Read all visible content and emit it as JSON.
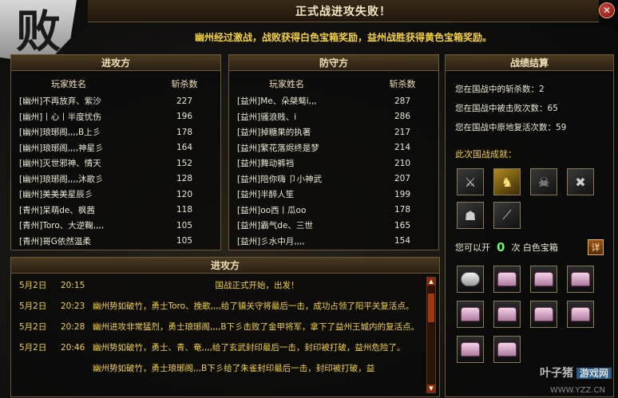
{
  "window": {
    "defeat_char": "败",
    "title": "正式战进攻失败！",
    "close_glyph": "✕",
    "banner": "幽州经过激战，战败获得白色宝箱奖励，益州战胜获得黄色宝箱奖励。"
  },
  "attack": {
    "header": "进攻方",
    "col_name": "玩家姓名",
    "col_kills": "斩杀数",
    "rows": [
      {
        "name": "[幽州]不再放弃、紫沙",
        "kills": "227"
      },
      {
        "name": "[幽州]丨心丨半度忧伤",
        "kills": "196"
      },
      {
        "name": "[幽州]琅琊阁,,,,B上彡",
        "kills": "178"
      },
      {
        "name": "[幽州]琅琊阁,,,,神星彡",
        "kills": "164"
      },
      {
        "name": "[幽州]灭世邪神、情天",
        "kills": "152"
      },
      {
        "name": "[幽州]琅琊阁,,,,沐歌彡",
        "kills": "128"
      },
      {
        "name": "[幽州]美美美星辰彡",
        "kills": "120"
      },
      {
        "name": "[青州]呆萌de、枫茜",
        "kills": "118"
      },
      {
        "name": "[青州]Toro、大逆鞠,,,,",
        "kills": "105"
      },
      {
        "name": "[青州]哥G依然温柔",
        "kills": "105"
      }
    ]
  },
  "defend": {
    "header": "防守方",
    "col_name": "玩家姓名",
    "col_kills": "斩杀数",
    "rows": [
      {
        "name": "[益州]Me、朵桀骜i,,,",
        "kills": "287"
      },
      {
        "name": "[益州]骚浪贱、i",
        "kills": "286"
      },
      {
        "name": "[益州]掉糖果的执著",
        "kills": "217"
      },
      {
        "name": "[益州]繁花落烬终是梦",
        "kills": "214"
      },
      {
        "name": "[益州]舞动裤裆",
        "kills": "210"
      },
      {
        "name": "[益州]陪你嗨 卩小神武",
        "kills": "207"
      },
      {
        "name": "[益州]半醉人笙",
        "kills": "199"
      },
      {
        "name": "[益州]oo西丨瓜oo",
        "kills": "178"
      },
      {
        "name": "[益州]霸气de、三世",
        "kills": "165"
      },
      {
        "name": "[益州]彡水中月,,,,",
        "kills": "154"
      }
    ]
  },
  "stats": {
    "header": "战绩结算",
    "kills_label": "您在国战中的斩杀数：2",
    "killed_label": "您在国战中被击败次数：65",
    "revive_label": "您在国战中原地复活次数：59",
    "achv_label": "此次国战成就：",
    "achievements": [
      {
        "icon": "crossed-blades-icon",
        "glyph": "⚔",
        "gold": false
      },
      {
        "icon": "golden-warrior-icon",
        "glyph": "♞",
        "gold": true
      },
      {
        "icon": "beast-icon",
        "glyph": "☠",
        "gold": false
      },
      {
        "icon": "broken-weapon-icon",
        "glyph": "✖",
        "gold": false
      },
      {
        "icon": "fallen-soldier-icon",
        "glyph": "☗",
        "gold": false
      },
      {
        "icon": "spear-icon",
        "glyph": "⟋",
        "gold": false
      }
    ],
    "open_prefix": "您可以开",
    "open_count": "0",
    "open_suffix": "次 白色宝箱",
    "open_button": "详"
  },
  "chests": [
    {
      "icon": "silver-ingot-icon",
      "silver": true
    },
    {
      "icon": "pink-chest-icon",
      "silver": false
    },
    {
      "icon": "pink-chest-icon",
      "silver": false
    },
    {
      "icon": "pink-chest-icon",
      "silver": false
    },
    {
      "icon": "pink-chest-icon",
      "silver": false
    },
    {
      "icon": "pink-chest-icon",
      "silver": false
    },
    {
      "icon": "pink-chest-icon",
      "silver": false
    },
    {
      "icon": "pink-chest-icon",
      "silver": false
    },
    {
      "icon": "pink-chest-icon",
      "silver": false
    },
    {
      "icon": "pink-chest-icon",
      "silver": false
    }
  ],
  "log": {
    "header": "进攻方",
    "entries": [
      {
        "date": "5月2日",
        "time": "20:15",
        "msg": "国战正式开始，出发！",
        "center": true
      },
      {
        "date": "5月2日",
        "time": "20:23",
        "msg": "幽州势如破竹，勇士Toro、挽歌,,,,给了镇关守将最后一击，成功占领了阳平关复活点。",
        "center": false
      },
      {
        "date": "5月2日",
        "time": "20:28",
        "msg": "幽州进攻非常猛烈，勇士琅琊阁,,,,B下彡击败了金甲将军，拿下了益州王城内的复活点。",
        "center": false
      },
      {
        "date": "5月2日",
        "time": "20:46",
        "msg": "幽州势如破竹，勇士、青、奄,,,,给了玄武封印最后一击，封印被打破，益州危险了。",
        "center": false
      },
      {
        "date": "",
        "time": "",
        "msg": "幽州势如破竹，勇士琅琊阁,,,B下彡给了朱雀封印最后一击，封印被打破，益",
        "center": false
      }
    ],
    "scroll_up": "▲",
    "scroll_down": "▼"
  },
  "watermark": {
    "brand": "叶子猪",
    "tag": "游戏网",
    "url": "WWW.YZZ.CN"
  }
}
